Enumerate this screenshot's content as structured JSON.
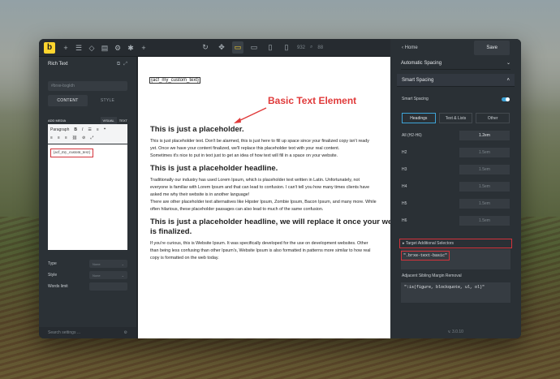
{
  "toolbar": {
    "logo": "b",
    "left_icons": [
      "plus-icon",
      "layers-icon",
      "shield-icon",
      "template-icon",
      "gear-icon",
      "settings-icon",
      "add-icon"
    ],
    "center_num_1": "932",
    "center_num_2": "88"
  },
  "left_panel": {
    "title": "Rich Text",
    "id_placeholder": "#brxe-bxgkth",
    "tabs": [
      "CONTENT",
      "STYLE"
    ],
    "editor_label": "ADD MEDIA",
    "editor_tabs": [
      "VISUAL",
      "TEXT"
    ],
    "format": "Paragraph",
    "editor_content": "{acf_my_custom_text}",
    "fields": [
      {
        "label": "Type",
        "value": "None"
      },
      {
        "label": "Style",
        "value": "None"
      },
      {
        "label": "Words limit",
        "value": ""
      }
    ],
    "search_placeholder": "Search settings ..."
  },
  "canvas": {
    "acf_tag": "{acf_my_custom_text}",
    "annotation": "Basic Text Element",
    "blocks": [
      {
        "type": "h",
        "text": "This is just a placeholder."
      },
      {
        "type": "p",
        "text": "This is just placeholder text. Don't be alarmed, this is just here to fill up space since your finalized copy isn't ready"
      },
      {
        "type": "p",
        "text": "yet. Once we have your content finalized, we'll replace this placeholder text with your real content."
      },
      {
        "type": "p",
        "text": "Sometimes it's nice to put in text just to get an idea of how text will fill in a space on your website."
      },
      {
        "type": "h",
        "text": "This is just a placeholder headline."
      },
      {
        "type": "p",
        "text": "Traditionally our industry has used Lorem Ipsum, which is placeholder text written in Latin. Unfortunately, not"
      },
      {
        "type": "p",
        "text": "everyone is familiar with Lorem Ipsum and that can lead to confusion. I can't tell you how many times clients have"
      },
      {
        "type": "p",
        "text": "asked me why their website is in another language!"
      },
      {
        "type": "p",
        "text": "There are other placeholder text alternatives like Hipster Ipsum, Zombie Ipsum, Bacon Ipsum, and many more. While"
      },
      {
        "type": "p",
        "text": "often hilarious, these placeholder passages can also lead to much of the same confusion."
      },
      {
        "type": "h",
        "text": "This is just a placeholder headline, we will replace it once your website copy"
      },
      {
        "type": "h",
        "text": "is finalized."
      },
      {
        "type": "p",
        "text": "If you're curious, this is Website Ipsum. It was specifically developed for the use on development websites. Other"
      },
      {
        "type": "p",
        "text": "than being less confusing than other Ipsum's, Website Ipsum is also formatted in patterns more similar to how real"
      },
      {
        "type": "p",
        "text": "copy is formatted on the web today."
      }
    ]
  },
  "right_panel": {
    "home": "Home",
    "save": "Save",
    "section_1": "Automatic Spacing",
    "section_2": "Smart Spacing",
    "smart_spacing_label": "Smart Spacing",
    "tabs": [
      "Headings",
      "Text & Lists",
      "Other"
    ],
    "rows": [
      {
        "label": "All (H2-H6)",
        "value": "1.2em"
      },
      {
        "label": "H2",
        "value": "1.5em"
      },
      {
        "label": "H3",
        "value": "1.5em"
      },
      {
        "label": "H4",
        "value": "1.5em"
      },
      {
        "label": "H5",
        "value": "1.5em"
      },
      {
        "label": "H6",
        "value": "1.5em"
      }
    ],
    "target_label": "Target Additional Selectors",
    "target_value": "\".brxe-text-basic\"",
    "adjacent_label": "Adjacent Sibling Margin Removal",
    "adjacent_value": "\":is(figure, blockquote, ul, ol)\"",
    "version": "v. 3.0.10"
  }
}
